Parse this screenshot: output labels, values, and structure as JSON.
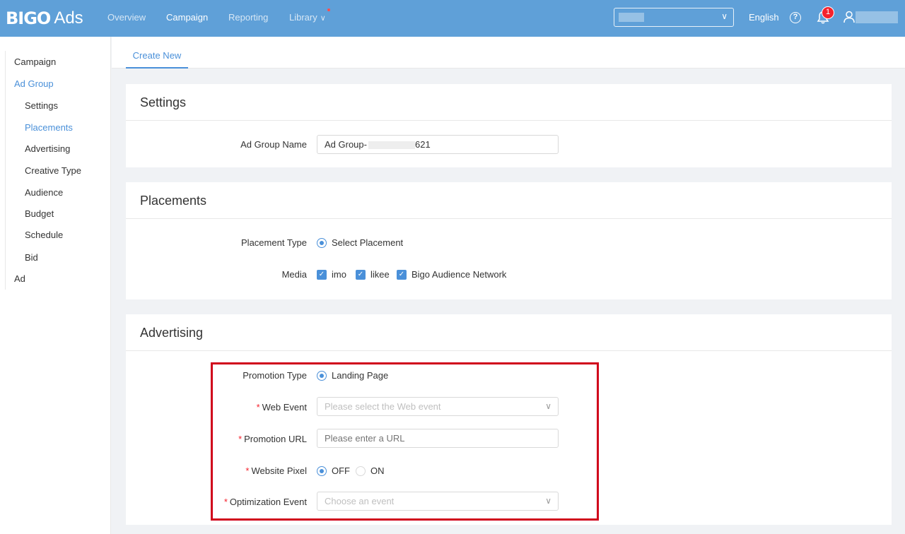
{
  "brand": {
    "bigo": "BIGO",
    "ads": "Ads"
  },
  "nav": {
    "overview": "Overview",
    "campaign": "Campaign",
    "reporting": "Reporting",
    "library": "Library",
    "library_chevron": "∨"
  },
  "header_right": {
    "language": "English",
    "help": "?",
    "notification_count": "1",
    "select_chevron": "∨"
  },
  "sidebar": {
    "campaign": "Campaign",
    "ad_group": "Ad Group",
    "settings": "Settings",
    "placements": "Placements",
    "advertising": "Advertising",
    "creative_type": "Creative Type",
    "audience": "Audience",
    "budget": "Budget",
    "schedule": "Schedule",
    "bid": "Bid",
    "ad": "Ad"
  },
  "tab": {
    "create_new": "Create New"
  },
  "settings": {
    "title": "Settings",
    "ad_group_name_label": "Ad Group Name",
    "ad_group_name_prefix": "Ad Group-",
    "ad_group_name_suffix": "621"
  },
  "placements": {
    "title": "Placements",
    "placement_type_label": "Placement Type",
    "placement_type_value": "Select Placement",
    "media_label": "Media",
    "media": [
      "imo",
      "likee",
      "Bigo Audience Network"
    ]
  },
  "advertising": {
    "title": "Advertising",
    "promotion_type_label": "Promotion Type",
    "promotion_type_value": "Landing Page",
    "web_event_label": "Web Event",
    "web_event_placeholder": "Please select the Web event",
    "promotion_url_label": "Promotion URL",
    "promotion_url_placeholder": "Please enter a URL",
    "website_pixel_label": "Website Pixel",
    "pixel_off": "OFF",
    "pixel_on": "ON",
    "optimization_event_label": "Optimization Event",
    "optimization_event_placeholder": "Choose an event",
    "required_mark": "*",
    "chevron": "∨"
  },
  "colors": {
    "topbar": "#5fa0d8",
    "accent": "#4a90d9",
    "required": "#f5222d",
    "highlight": "#d0021b"
  }
}
